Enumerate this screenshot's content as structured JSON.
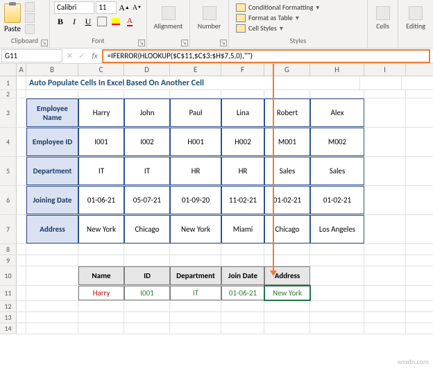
{
  "ribbon": {
    "clipboard": {
      "label": "Clipboard",
      "paste": "Paste"
    },
    "font": {
      "label": "Font",
      "name": "Calibri",
      "size": "11",
      "bold": "B",
      "italic": "I",
      "underline": "U",
      "grow": "A",
      "shrink": "A"
    },
    "alignment": {
      "label": "Alignment"
    },
    "number": {
      "label": "Number"
    },
    "styles": {
      "label": "Styles",
      "conditional": "Conditional Formatting",
      "table": "Format as Table",
      "cell": "Cell Styles"
    },
    "cells": {
      "label": "Cells"
    },
    "editing": {
      "label": "Editing"
    }
  },
  "namebox": "G11",
  "fx": "fx",
  "formula": "=IFERROR(HLOOKUP($C$11,$C$3:$H$7,5,0),\"\")",
  "columns": [
    "A",
    "B",
    "C",
    "D",
    "E",
    "F",
    "G",
    "H",
    "I"
  ],
  "title": "Auto Populate Cells In Excel Based On Another Cell",
  "table1": {
    "rowHeaders": [
      "Employee Name",
      "Employee ID",
      "Department",
      "Joining Date",
      "Address"
    ],
    "data": [
      [
        "Harry",
        "John",
        "Paul",
        "Lina",
        "Robert",
        "Alex"
      ],
      [
        "I001",
        "I002",
        "H001",
        "H002",
        "M001",
        "M002"
      ],
      [
        "IT",
        "IT",
        "HR",
        "HR",
        "Sales",
        "Sales"
      ],
      [
        "01-06-21",
        "05-07-21",
        "01-09-20",
        "11-02-21",
        "01-02-21",
        "01-02-21"
      ],
      [
        "New York",
        "Chicago",
        "New York",
        "Miami",
        "Chicago",
        "Los Angeles"
      ]
    ]
  },
  "table2": {
    "headers": [
      "Name",
      "ID",
      "Department",
      "Join Date",
      "Address"
    ],
    "values": [
      "Harry",
      "I001",
      "IT",
      "01-06-21",
      "New York"
    ]
  },
  "watermark": "wsxdn.com"
}
